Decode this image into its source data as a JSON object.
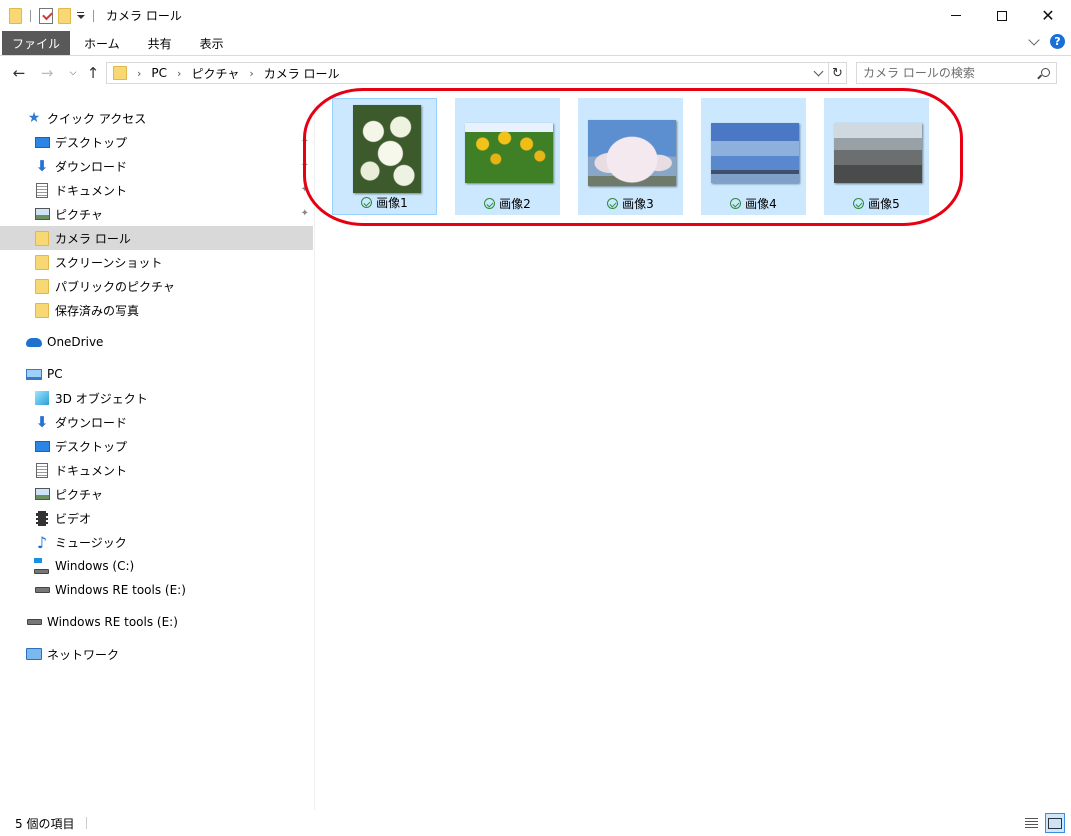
{
  "window": {
    "title": "カメラ ロール"
  },
  "ribbon": {
    "tabs": [
      "ファイル",
      "ホーム",
      "共有",
      "表示"
    ]
  },
  "address": {
    "crumbs": [
      "PC",
      "ピクチャ",
      "カメラ ロール"
    ],
    "search_placeholder": "カメラ ロールの検索"
  },
  "nav": {
    "quick_access": "クイック アクセス",
    "quick_items": [
      "デスクトップ",
      "ダウンロード",
      "ドキュメント",
      "ピクチャ",
      "カメラ ロール",
      "スクリーンショット",
      "パブリックのピクチャ",
      "保存済みの写真"
    ],
    "onedrive": "OneDrive",
    "pc": "PC",
    "pc_items": [
      "3D オブジェクト",
      "ダウンロード",
      "デスクトップ",
      "ドキュメント",
      "ピクチャ",
      "ビデオ",
      "ミュージック",
      "Windows (C:)",
      "Windows RE tools (E:)"
    ],
    "drive_e": "Windows RE tools (E:)",
    "network": "ネットワーク",
    "selected": "カメラ ロール"
  },
  "files": [
    {
      "name": "画像1",
      "status": "synced",
      "thumb": "flowers"
    },
    {
      "name": "画像2",
      "status": "synced",
      "thumb": "sunflowers"
    },
    {
      "name": "画像3",
      "status": "synced",
      "thumb": "cherry-blossoms"
    },
    {
      "name": "画像4",
      "status": "synced",
      "thumb": "sky"
    },
    {
      "name": "画像5",
      "status": "synced",
      "thumb": "sprout"
    }
  ],
  "status": {
    "count": "5 個の項目"
  },
  "colors": {
    "selection": "#cce8ff",
    "highlight_circle": "#e60012",
    "file_tab": "#595959",
    "nav_selected": "#d9d9d9"
  }
}
